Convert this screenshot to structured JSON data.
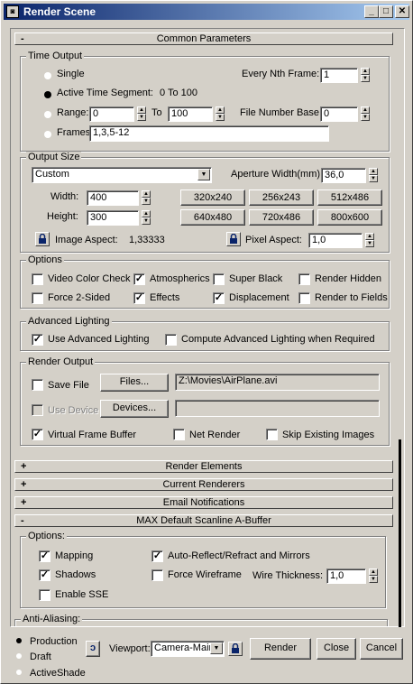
{
  "window": {
    "title": "Render Scene"
  },
  "common": {
    "header": "Common Parameters",
    "time_output": {
      "label": "Time Output",
      "single": "Single",
      "every_nth_label": "Every Nth Frame:",
      "every_nth_value": "1",
      "active_segment": "Active Time Segment:",
      "active_segment_value": "0 To 100",
      "range": "Range:",
      "range_from": "0",
      "to": "To",
      "range_to": "100",
      "file_number_base_label": "File Number Base:",
      "file_number_base_value": "0",
      "frames_label": "Frames",
      "frames_value": "1,3,5-12",
      "selected": "Active Time Segment:"
    },
    "output_size": {
      "label": "Output Size",
      "preset": "Custom",
      "aperture_label": "Aperture Width(mm):",
      "aperture_value": "36,0",
      "width_label": "Width:",
      "width_value": "400",
      "height_label": "Height:",
      "height_value": "300",
      "presets": [
        "320x240",
        "256x243",
        "512x486",
        "640x480",
        "720x486",
        "800x600"
      ],
      "image_aspect_label": "Image Aspect:",
      "image_aspect_value": "1,33333",
      "pixel_aspect_label": "Pixel Aspect:",
      "pixel_aspect_value": "1,0"
    },
    "options": {
      "label": "Options",
      "items": [
        {
          "label": "Video Color Check",
          "checked": false
        },
        {
          "label": "Atmospherics",
          "checked": true
        },
        {
          "label": "Super Black",
          "checked": false
        },
        {
          "label": "Render Hidden",
          "checked": false
        },
        {
          "label": "Force 2-Sided",
          "checked": false
        },
        {
          "label": "Effects",
          "checked": true
        },
        {
          "label": "Displacement",
          "checked": true
        },
        {
          "label": "Render to Fields",
          "checked": false
        }
      ]
    },
    "advanced_lighting": {
      "label": "Advanced Lighting",
      "use_label": "Use Advanced Lighting",
      "use_checked": true,
      "compute_label": "Compute Advanced Lighting when Required",
      "compute_checked": false
    },
    "render_output": {
      "label": "Render Output",
      "save_file": "Save File",
      "files_button": "Files...",
      "file_path": "Z:\\Movies\\AirPlane.avi",
      "use_device": "Use Device",
      "devices_button": "Devices...",
      "virtual_frame_buffer": "Virtual Frame Buffer",
      "net_render": "Net Render",
      "skip_existing": "Skip Existing Images"
    }
  },
  "rollouts": [
    {
      "sign": "+",
      "label": "Render Elements"
    },
    {
      "sign": "+",
      "label": "Current Renderers"
    },
    {
      "sign": "+",
      "label": "Email Notifications"
    },
    {
      "sign": "-",
      "label": "MAX Default Scanline A-Buffer"
    }
  ],
  "scanline": {
    "options_label": "Options:",
    "mapping": "Mapping",
    "auto_reflect": "Auto-Reflect/Refract and Mirrors",
    "shadows": "Shadows",
    "force_wireframe": "Force Wireframe",
    "wire_thickness_label": "Wire Thickness:",
    "wire_thickness_value": "1,0",
    "enable_sse": "Enable SSE",
    "anti_aliasing_label": "Anti-Aliasing:"
  },
  "bottom": {
    "modes": [
      "Production",
      "Draft",
      "ActiveShade"
    ],
    "selected_mode": "Production",
    "viewport_label": "Viewport:",
    "viewport_value": "Camera-Main",
    "render_button": "Render",
    "close_button": "Close",
    "cancel_button": "Cancel"
  }
}
